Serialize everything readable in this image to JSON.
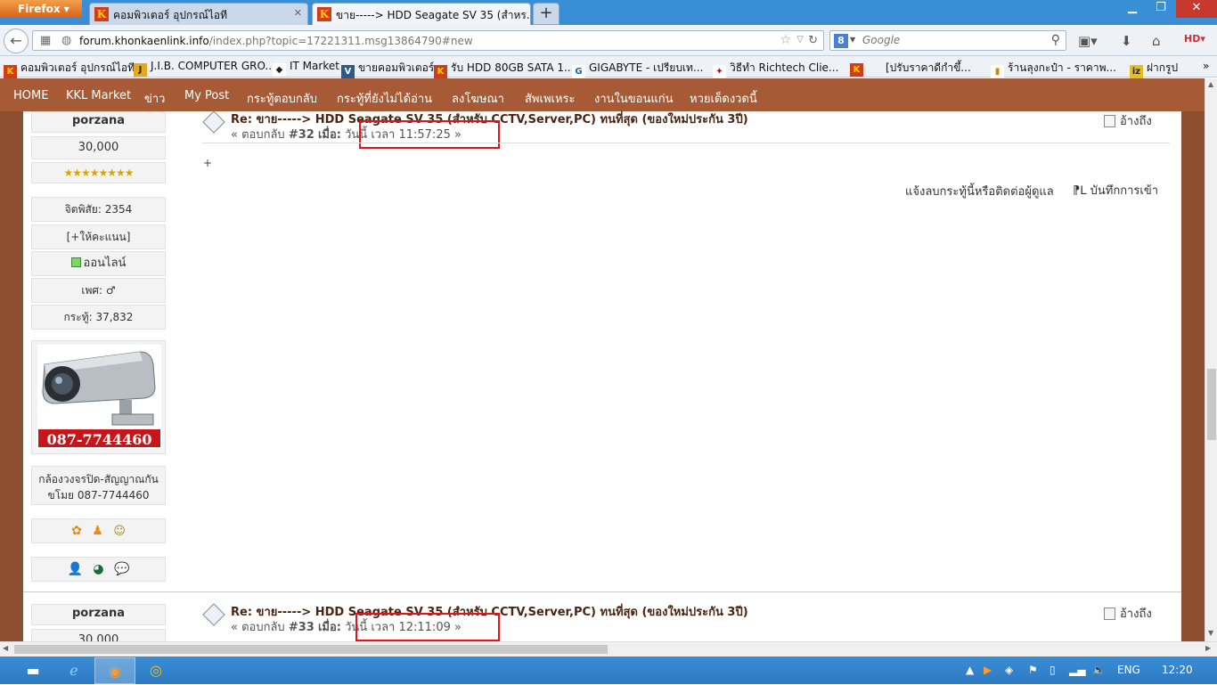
{
  "browser": {
    "app_button": "Firefox",
    "tabs": [
      {
        "label": "คอมพิวเตอร์ อุปกรณ์ไอที",
        "active": false
      },
      {
        "label": "ขาย-----> HDD Seagate SV 35 (สำหร...",
        "active": true
      }
    ],
    "url_host": "forum.khonkaenlink.info",
    "url_path": "/index.php?topic=17221311.msg13864790#new",
    "search_placeholder": "Google",
    "bookmarks": [
      "คอมพิวเตอร์ อุปกรณ์ไอที",
      "J.I.B. COMPUTER GRO...",
      "IT Market",
      "ขายคอมพิวเตอร์",
      "รับ HDD 80GB SATA 1...",
      "GIGABYTE - เปรียบเท...",
      "วิธีทำ Richtech Clie...",
      "[ปรับราคาดีกำขึ้...",
      "ร้านลุงกะป๋า - ราคาพ...",
      "ฝากรูป"
    ]
  },
  "site_menu": [
    "HOME",
    "KKL Market",
    "ข่าว",
    "My Post",
    "กระทู้ตอบกลับ",
    "กระทู้ที่ยังไม่ได้อ่าน",
    "ลงโฆษณา",
    "สัพเพเหระ",
    "งานในขอนแก่น",
    "หวยเด็ดงวดนี้"
  ],
  "poster": {
    "username": "porzana",
    "rank_value": "30,000",
    "stars": "★★★★★★★★",
    "karma": "จิตพิสัย: 2354",
    "give_points": "[+ให้คะแนน]",
    "status": "ออนไลน์",
    "gender": "เพศ: ♂",
    "posts": "กระทู้: 37,832",
    "phone_banner": "087-7744460",
    "signature": "กล้องวงจรปิด-สัญญาณกันขโมย 087-7744460"
  },
  "posts": [
    {
      "title": "Re: ขาย-----> HDD Seagate SV 35 (สำหรับ CCTV,Server,PC) ทนที่สุด (ของใหม่ประกัน 3ปี)",
      "reply_prefix": "« ตอบกลับ",
      "reply_no": "#32",
      "when_label": "เมื่อ:",
      "time_text": "วันนี้ เวลา 11:57:25 »",
      "body": "+",
      "quote_label": "อ้างถึง",
      "report_label": "แจ้งลบกระทู้นี้หรือติดต่อผู้ดูแล",
      "logged_label": "บันทึกการเข้า"
    },
    {
      "title": "Re: ขาย-----> HDD Seagate SV 35 (สำหรับ CCTV,Server,PC) ทนที่สุด (ของใหม่ประกัน 3ปี)",
      "reply_prefix": "« ตอบกลับ",
      "reply_no": "#33",
      "when_label": "เมื่อ:",
      "time_text": "วันนี้ เวลา 12:11:09 »",
      "quote_label": "อ้างถึง",
      "username": "porzana",
      "rank_value": "30,000"
    }
  ],
  "taskbar": {
    "lang": "ENG",
    "clock": "12:20"
  }
}
